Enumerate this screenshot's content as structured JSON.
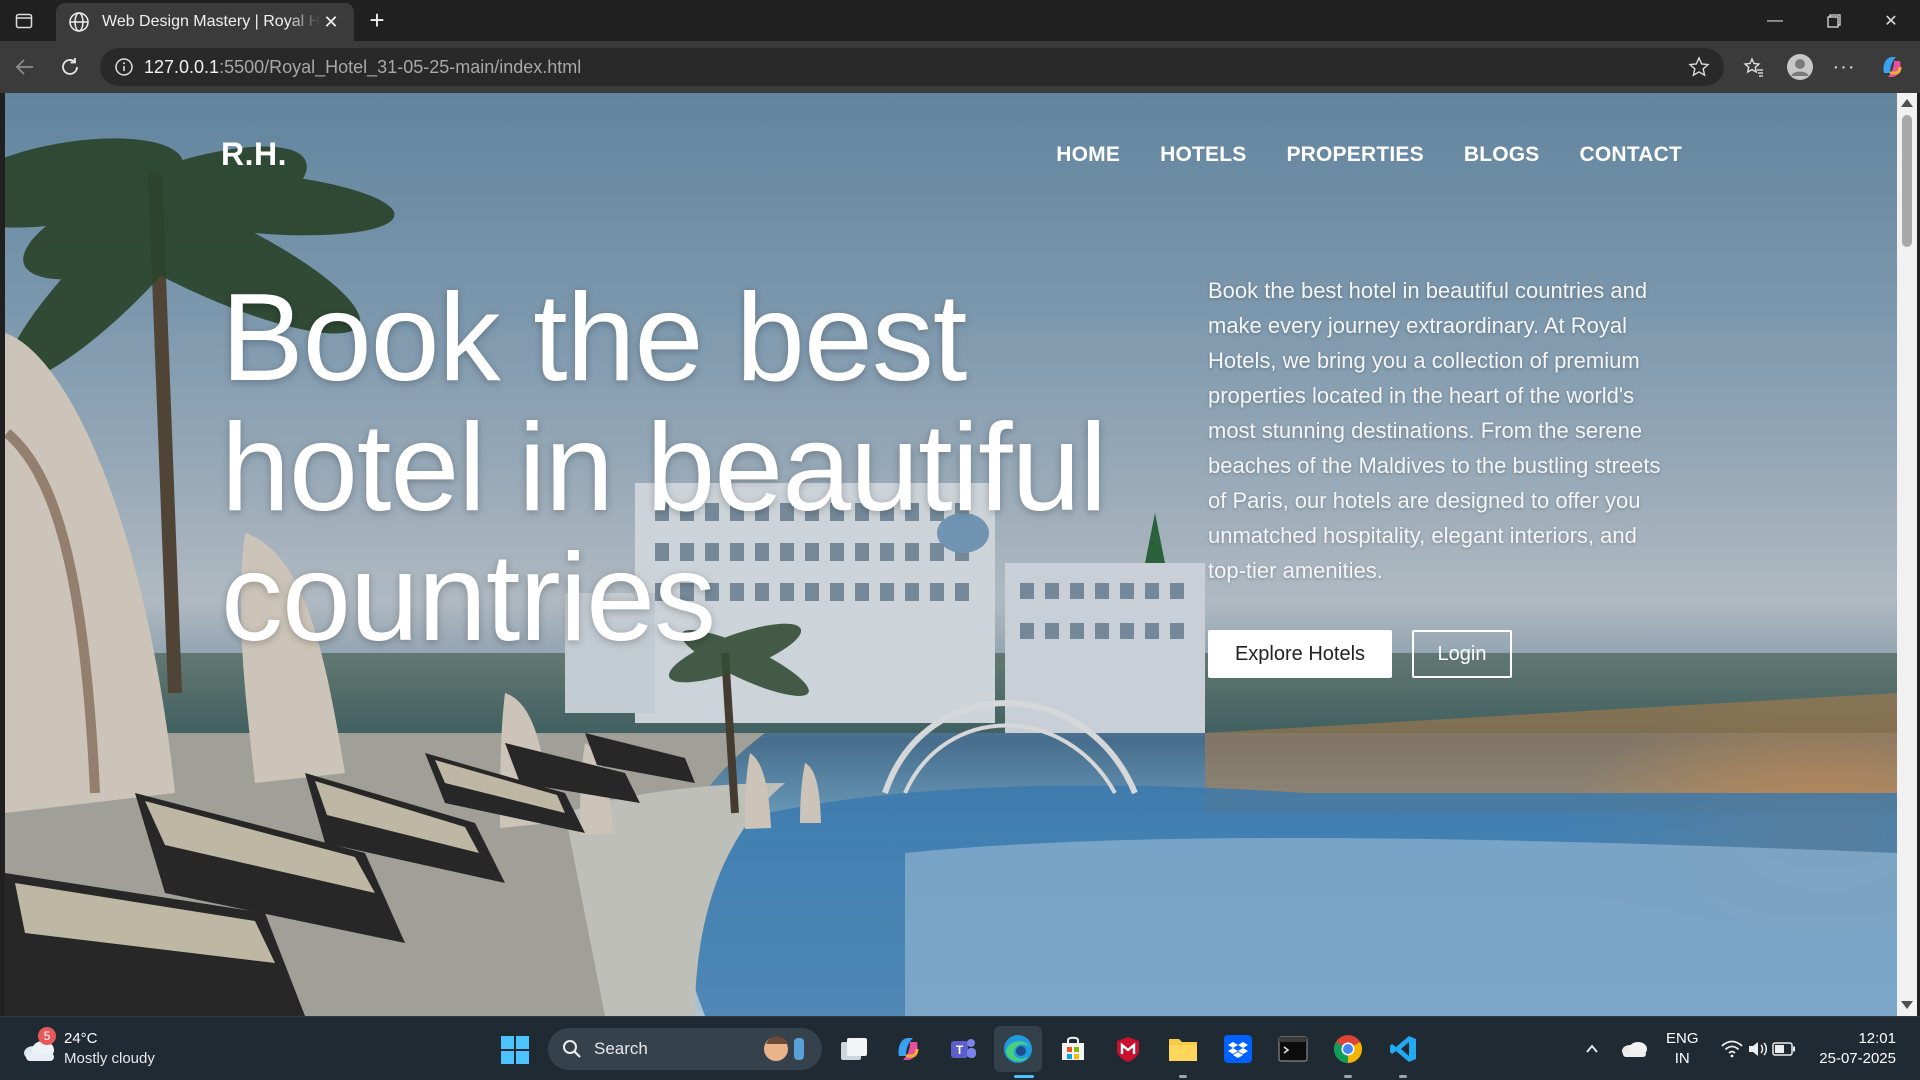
{
  "browser": {
    "tab_title": "Web Design Mastery | Royal Hotel",
    "url_host": "127.0.0.1",
    "url_path": ":5500/Royal_Hotel_31-05-25-main/index.html"
  },
  "site": {
    "logo": "R.H.",
    "nav": [
      "HOME",
      "HOTELS",
      "PROPERTIES",
      "BLOGS",
      "CONTACT"
    ],
    "hero_title": "Book the best hotel in beautiful countries",
    "hero_text": "Book the best hotel in beautiful countries and make every journey extraordinary. At Royal Hotels, we bring you a collection of premium properties located in the heart of the world's most stunning destinations. From the serene beaches of the Maldives to the bustling streets of Paris, our hotels are designed to offer you unmatched hospitality, elegant interiors, and top-tier amenities.",
    "primary_button": "Explore Hotels",
    "secondary_button": "Login"
  },
  "taskbar": {
    "weather_badge": "5",
    "temperature": "24°C",
    "condition": "Mostly cloudy",
    "search_placeholder": "Search",
    "lang_top": "ENG",
    "lang_bottom": "IN",
    "time": "12:01",
    "date": "25-07-2025"
  },
  "icons": [
    "globe-icon",
    "close-icon",
    "back-icon",
    "reload-icon",
    "info-icon",
    "star-icon",
    "favorites-icon",
    "profile-icon",
    "more-icon",
    "copilot-icon"
  ]
}
